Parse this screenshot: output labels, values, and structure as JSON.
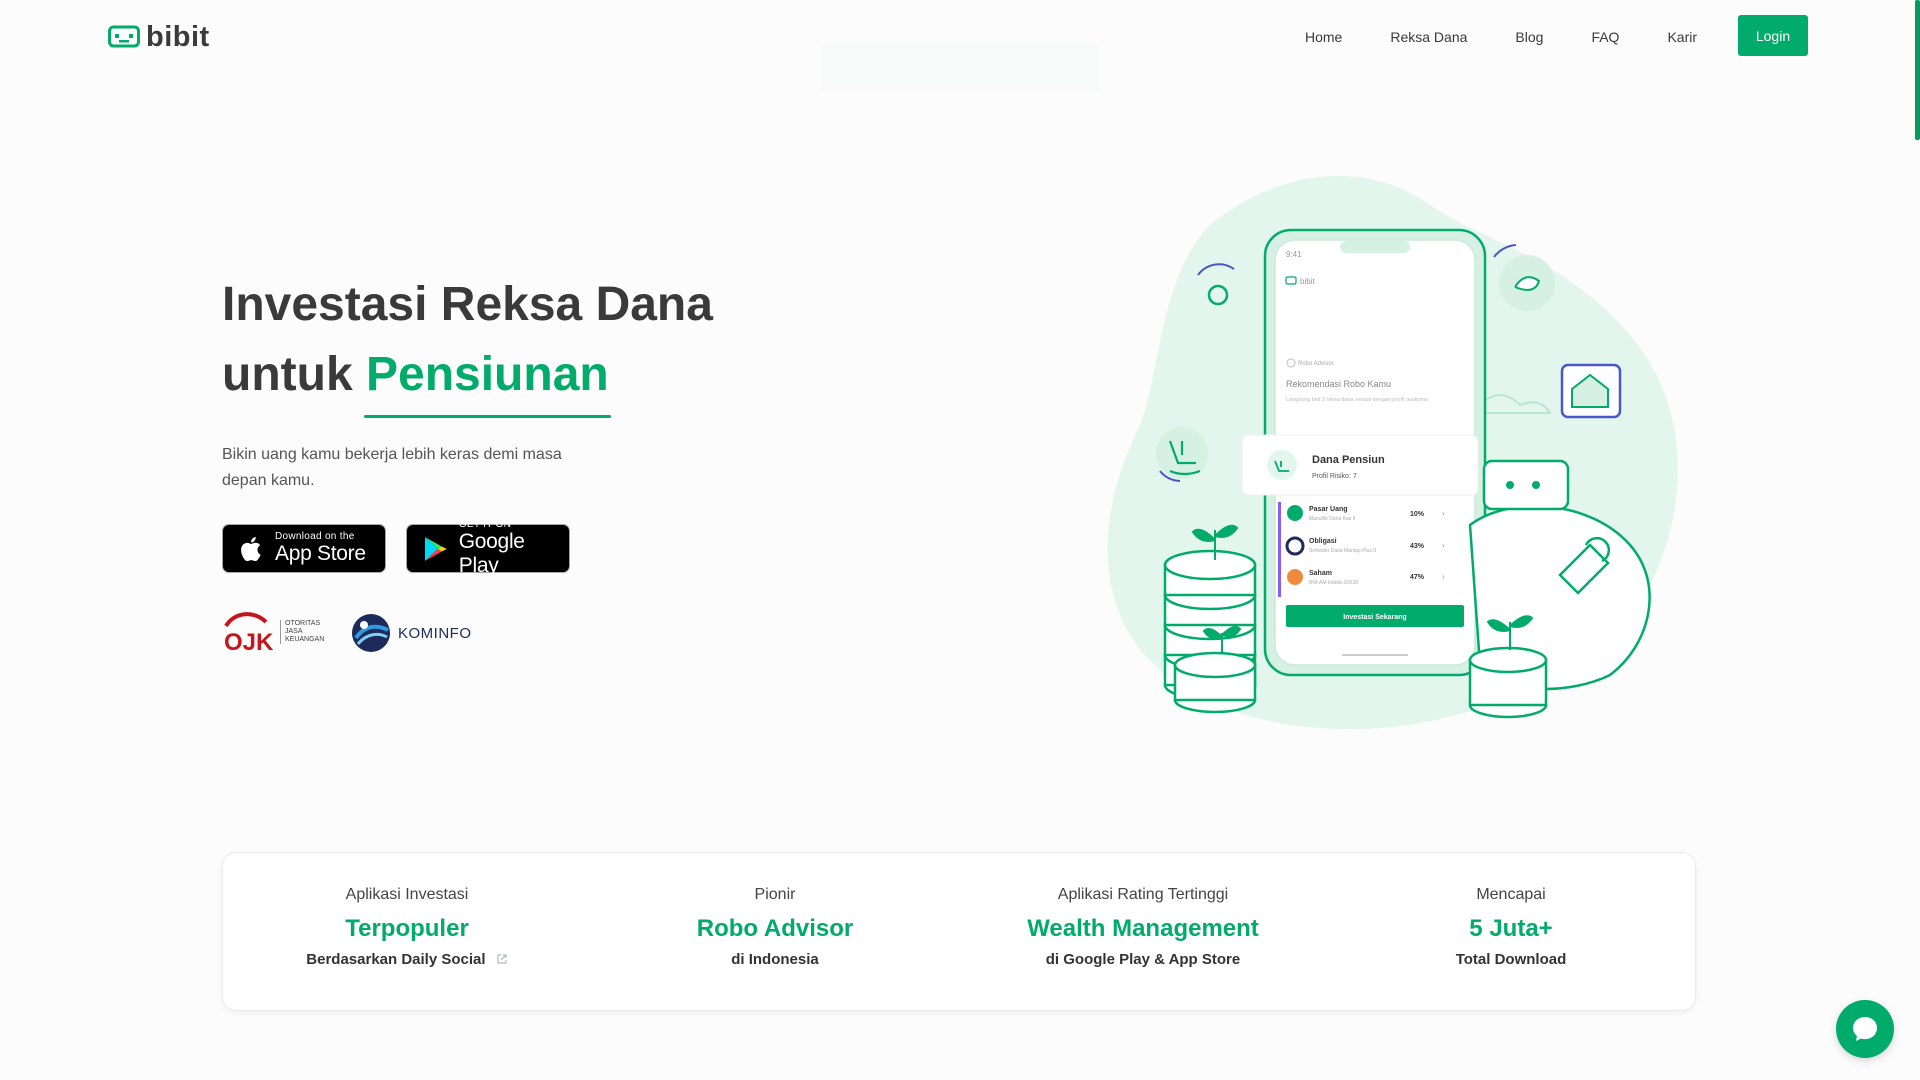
{
  "header": {
    "logo_text": "bibit",
    "nav": [
      "Home",
      "Reksa Dana",
      "Blog",
      "FAQ",
      "Karir"
    ],
    "login_label": "Login"
  },
  "hero": {
    "title_line1": "Investasi Reksa Dana",
    "title_line2_prefix": "untuk ",
    "title_line2_accent": "Pensiunan",
    "subtitle": "Bikin uang kamu bekerja lebih keras demi masa depan kamu."
  },
  "badges": {
    "appstore_small": "Download on the",
    "appstore_big": "App Store",
    "google_small": "GET IT ON",
    "google_big": "Google Play"
  },
  "partners": {
    "ojk_logo": "OJK",
    "ojk_text": [
      "OTORITAS",
      "JASA",
      "KEUANGAN"
    ],
    "kominfo_text": "KOMINFO"
  },
  "phone": {
    "time": "9:41",
    "app_name": "bibit",
    "robo_label": "Robo Advisor",
    "reco_title": "Rekomendasi Robo Kamu",
    "reco_desc": "Langsung beli 3 reksa dana sesuai dengan profil resikomu",
    "card_title": "Dana Pensiun",
    "card_profile": "Profil Risiko: 7",
    "funds": [
      {
        "name": "Pasar Uang",
        "desc": "Manulife Dana Kas II",
        "pct": "10%"
      },
      {
        "name": "Obligasi",
        "desc": "Schroder Dana Mantap Plus II",
        "pct": "43%"
      },
      {
        "name": "Saham",
        "desc": "BNI-AM Indeks IDX30",
        "pct": "47%"
      }
    ],
    "cta": "Investasi Sekarang"
  },
  "stats": [
    {
      "pre": "Aplikasi Investasi",
      "main": "Terpopuler",
      "sub": "Berdasarkan Daily Social"
    },
    {
      "pre": "Pionir",
      "main": "Robo Advisor",
      "sub": "di Indonesia"
    },
    {
      "pre": "Aplikasi Rating Tertinggi",
      "main": "Wealth Management",
      "sub": "di Google Play & App Store"
    },
    {
      "pre": "Mencapai",
      "main": "5 Juta+",
      "sub": "Total Download"
    }
  ],
  "colors": {
    "brand": "#00ab6b",
    "illustration_blob": "#e3f6ee",
    "text_dark": "#3a3a3a"
  },
  "icons": {
    "chat": "chat-bubble-icon",
    "external_link": "external-link-icon",
    "apple": "apple-icon",
    "google_play": "google-play-icon"
  }
}
